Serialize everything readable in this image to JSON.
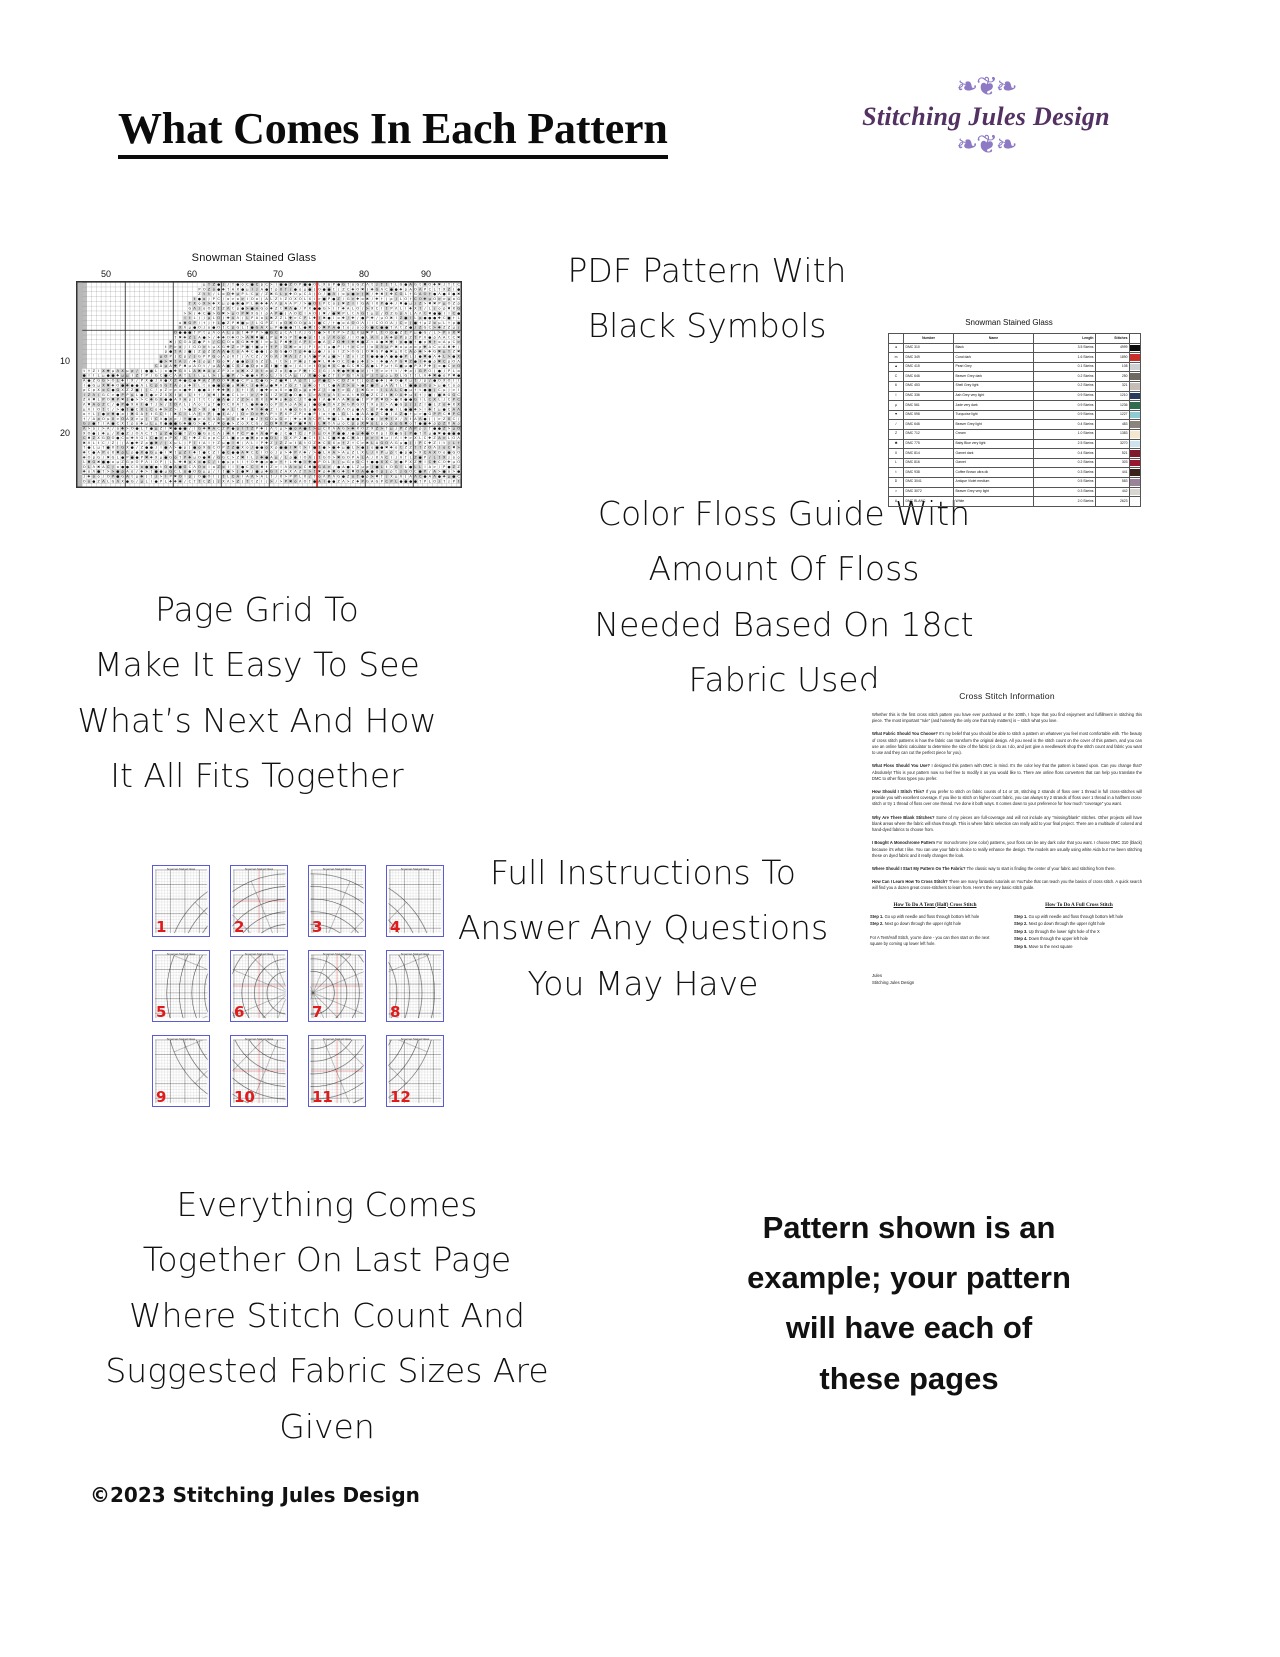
{
  "header": {
    "title": "What Comes In Each Pattern",
    "logo": {
      "brand": "Stitching Jules Design",
      "flourish_top": "❧❦❧",
      "flourish_bottom": "❧❦❧",
      "color": "#533162",
      "accent_color": "#8d79c4"
    }
  },
  "captions": {
    "pdf_pattern": "PDF Pattern With\nBlack Symbols",
    "page_grid": "Page Grid To\nMake It Easy To See\nWhat’s Next And How\nIt All Fits Together",
    "color_floss": "Color Floss Guide With\nAmount Of Floss\nNeeded Based On 18ct\nFabric Used",
    "full_instructions": "Full Instructions To\nAnswer Any Questions\nYou May Have",
    "everything_comes": "Everything Comes\nTogether On Last Page\nWhere Stitch Count And\nSuggested Fabric Sizes Are\nGiven",
    "pattern_example": "Pattern shown is an\nexample; your pattern\nwill have each of\nthese pages"
  },
  "footer": {
    "copyright": "©2023 Stitching Jules Design"
  },
  "chart_preview": {
    "title": "Snowman Stained Glass",
    "column_labels": [
      "50",
      "60",
      "70",
      "80",
      "90"
    ],
    "row_labels": [
      "10",
      "20"
    ],
    "center_marker_color": "#e01b1b",
    "center_arrow": "▼"
  },
  "floss_table": {
    "title": "Snowman Stained Glass",
    "columns": [
      "",
      "Number",
      "Name",
      "Length",
      "Stitches",
      ""
    ],
    "rows": [
      {
        "symbol": "●",
        "number": "DMC   310",
        "name": "Black",
        "length": "3.5 Skeins",
        "stitches": "4999",
        "color": "#0a0a0a"
      },
      {
        "symbol": "m",
        "number": "DMC   349",
        "name": "Coral dark",
        "length": "1.6 Skeins",
        "stitches": "1890",
        "color": "#c9302c"
      },
      {
        "symbol": "▲",
        "number": "DMC   415",
        "name": "Pearl Grey",
        "length": "0.1 Skeins",
        "stitches": "108",
        "color": "#cdd0d4"
      },
      {
        "symbol": "C",
        "number": "DMC   646",
        "name": "Beaver Grey dark",
        "length": "0.2 Skeins",
        "stitches": "250",
        "color": "#6f6b63"
      },
      {
        "symbol": "6",
        "number": "DMC   453",
        "name": "Shell Grey light",
        "length": "0.2 Skeins",
        "stitches": "321",
        "color": "#c6bdb6"
      },
      {
        "symbol": "I",
        "number": "DMC   336",
        "name": "Ash Grey very light",
        "length": "0.9 Skeins",
        "stitches": "1210",
        "color": "#2c3a60"
      },
      {
        "symbol": "µ",
        "number": "DMC   561",
        "name": "Jade very dark",
        "length": "0.9 Skeins",
        "stitches": "1236",
        "color": "#2f6b4f"
      },
      {
        "symbol": "▼",
        "number": "DMC   598",
        "name": "Turquoise light",
        "length": "0.9 Skeins",
        "stitches": "1227",
        "color": "#8fcbd2"
      },
      {
        "symbol": "/",
        "number": "DMC   646",
        "name": "Beaver Grey light",
        "length": "0.4 Skeins",
        "stitches": "483",
        "color": "#8a857c"
      },
      {
        "symbol": "Z",
        "number": "DMC   712",
        "name": "Cream",
        "length": "1.0 Skeins",
        "stitches": "1383",
        "color": "#f3e7cf"
      },
      {
        "symbol": "✱",
        "number": "DMC   775",
        "name": "Baby Blue very light",
        "length": "2.5 Skeins",
        "stitches": "3270",
        "color": "#cfe2ef"
      },
      {
        "symbol": "X",
        "number": "DMC   814",
        "name": "Garnet dark",
        "length": "0.4 Skeins",
        "stitches": "521",
        "color": "#7d1a2b"
      },
      {
        "symbol": "L",
        "number": "DMC   816",
        "name": "Garnet",
        "length": "0.2 Skeins",
        "stitches": "303",
        "color": "#97182c"
      },
      {
        "symbol": "t",
        "number": "DMC   938",
        "name": "Coffee Brown ultra dk",
        "length": "0.3 Skeins",
        "stitches": "441",
        "color": "#3a2318"
      },
      {
        "symbol": "D",
        "number": "DMC   3041",
        "name": "Antique Violet medium",
        "length": "0.5 Skeins",
        "stitches": "583",
        "color": "#9a8398"
      },
      {
        "symbol": ">",
        "number": "DMC   3072",
        "name": "Beaver Grey very light",
        "length": "0.3 Skeins",
        "stitches": "442",
        "color": "#d8d6ce"
      },
      {
        "symbol": "A",
        "number": "DMC   BLANC",
        "name": "White",
        "length": "2.0 Skeins",
        "stitches": "2623",
        "color": "#fdfdfd"
      }
    ]
  },
  "instructions_page": {
    "title": "Cross Stitch Information",
    "paragraphs": [
      {
        "heading": "",
        "text": "Whether this is the first cross stitch pattern you have ever purchased or the 100th, I hope that you find enjoyment and fulfillment in stitching this piece. The most important “rule” (and honestly the only one that truly matters) is – stitch what you love."
      },
      {
        "heading": "What Fabric Should You Choose?",
        "text": "It’s my belief that you should be able to stitch a pattern on whatever you feel most comfortable with. The beauty of cross stitch patterns is how the fabric can transform the original design. All you need is the stitch count on the cover of this pattern, and you can use an online fabric calculator to determine the size of the fabric (or do as I do, and just give a needlework shop the stitch count and fabric you want to use and they can cut the perfect piece for you)."
      },
      {
        "heading": "What Floss Should You Use?",
        "text": "I designed this pattern with DMC in mind. It’s the color key that the pattern is based upon. Can you change that? Absolutely! This is your pattern now so feel free to modify it as you would like to. There are online floss converters that can help you translate the DMC to other floss types you prefer."
      },
      {
        "heading": "How Should I Stitch This?",
        "text": "If you prefer to stitch on fabric counts of 14 or 18, stitching 2 strands of floss over 1 thread in full cross-stitches will provide you with excellent coverage. If you like to stitch on higher count fabric, you can always try 2 strands of floss over 1 thread in a half/tent cross-stitch or try 1 thread of floss over one thread. I’ve done it both ways. It comes down to your preference for how much “coverage” you want."
      },
      {
        "heading": "Why Are There Blank Stitches?",
        "text": "Some of my pieces are full-coverage and will not include any “missing/blank” stitches. Other projects will have blank areas where the fabric will show through. This is where fabric selection can really add to your final project. There are a multitude of colored and hand-dyed fabrics to choose from."
      },
      {
        "heading": "I Bought A Monochrome Pattern",
        "text": "For monochrome (one color) patterns, your floss can be any dark color that you want. I choose DMC 310 (black) because it’s what I like. You can use your fabric choice to really enhance the design. The models are usually using white Aida but I’ve been stitching these on dyed fabric and it really changes the look."
      },
      {
        "heading": "Where Should I Start My Pattern On The Fabric?",
        "text": "The classic way to start is finding the center of your fabric and stitching from there."
      },
      {
        "heading": "How Can I Learn How To Cross Stitch?",
        "text": "There are many fantastic tutorials on YouTube that can teach you the basics of cross stitch. A quick search will find you a dozen great cross-stitchers to learn from. Here’s the very basic stitch guide."
      }
    ],
    "columns": [
      {
        "heading": "How To Do A Tent (Half) Cross Stitch",
        "steps": [
          "Step 1. Go up with needle and floss through bottom left hole",
          "Step 2. Next go down through the upper right hole"
        ],
        "note": "For A Tent/Half Stitch, you’re done - you can then start on the next square by coming up lower left hole."
      },
      {
        "heading": "How To Do A Full Cross Stitch",
        "steps": [
          "Step 1. Go up with needle and floss through bottom left hole",
          "Step 2. Next go down through the upper right hole",
          "Step 3. Up through the lower right hole of the X",
          "Step 4. Down through the upper left hole",
          "Step 5. Move to the next square"
        ],
        "note": ""
      }
    ],
    "signature": "Jules\nStitching Jules Design"
  },
  "page_grid": {
    "page_title": "Snowman Stained Glass",
    "numbers": [
      "1",
      "2",
      "3",
      "4",
      "5",
      "6",
      "7",
      "8",
      "9",
      "10",
      "11",
      "12"
    ],
    "border_color": "#5b5bd6",
    "number_color": "#e01b1b"
  }
}
